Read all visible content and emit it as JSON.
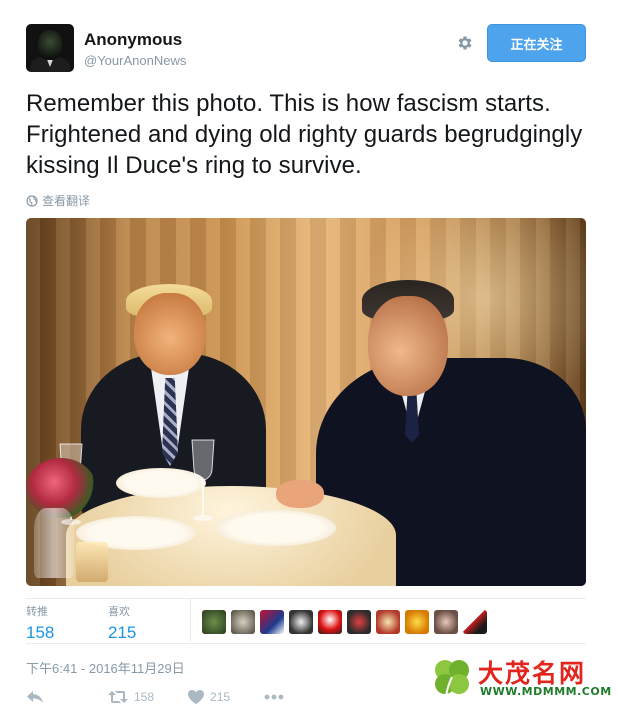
{
  "tweet": {
    "author_name": "Anonymous",
    "author_handle": "@YourAnonNews",
    "follow_button_label": "正在关注",
    "text": "Remember this photo. This is how fascism starts. Frightened and dying old righty guards begrudgingly kissing Il Duce's ring to survive.",
    "translate_label": "查看翻译",
    "stats": {
      "retweets_label": "转推",
      "retweets_count": "158",
      "likes_label": "喜欢",
      "likes_count": "215"
    },
    "liker_avatar_count": 10,
    "timestamp": "下午6:41 - 2016年11月29日",
    "actions": {
      "reply_icon": "reply-icon",
      "retweet_icon": "retweet-icon",
      "retweet_count": "158",
      "like_icon": "heart-icon",
      "like_count": "215",
      "more_icon": "more-icon"
    }
  },
  "watermark": {
    "title": "大茂名网",
    "url": "WWW.MDMMM.COM"
  },
  "colors": {
    "follow_button": "#4da3ec",
    "link_blue": "#1b95e0",
    "muted_gray": "#8899a6",
    "watermark_red": "#e2251c",
    "watermark_green": "#1f7a2a"
  }
}
